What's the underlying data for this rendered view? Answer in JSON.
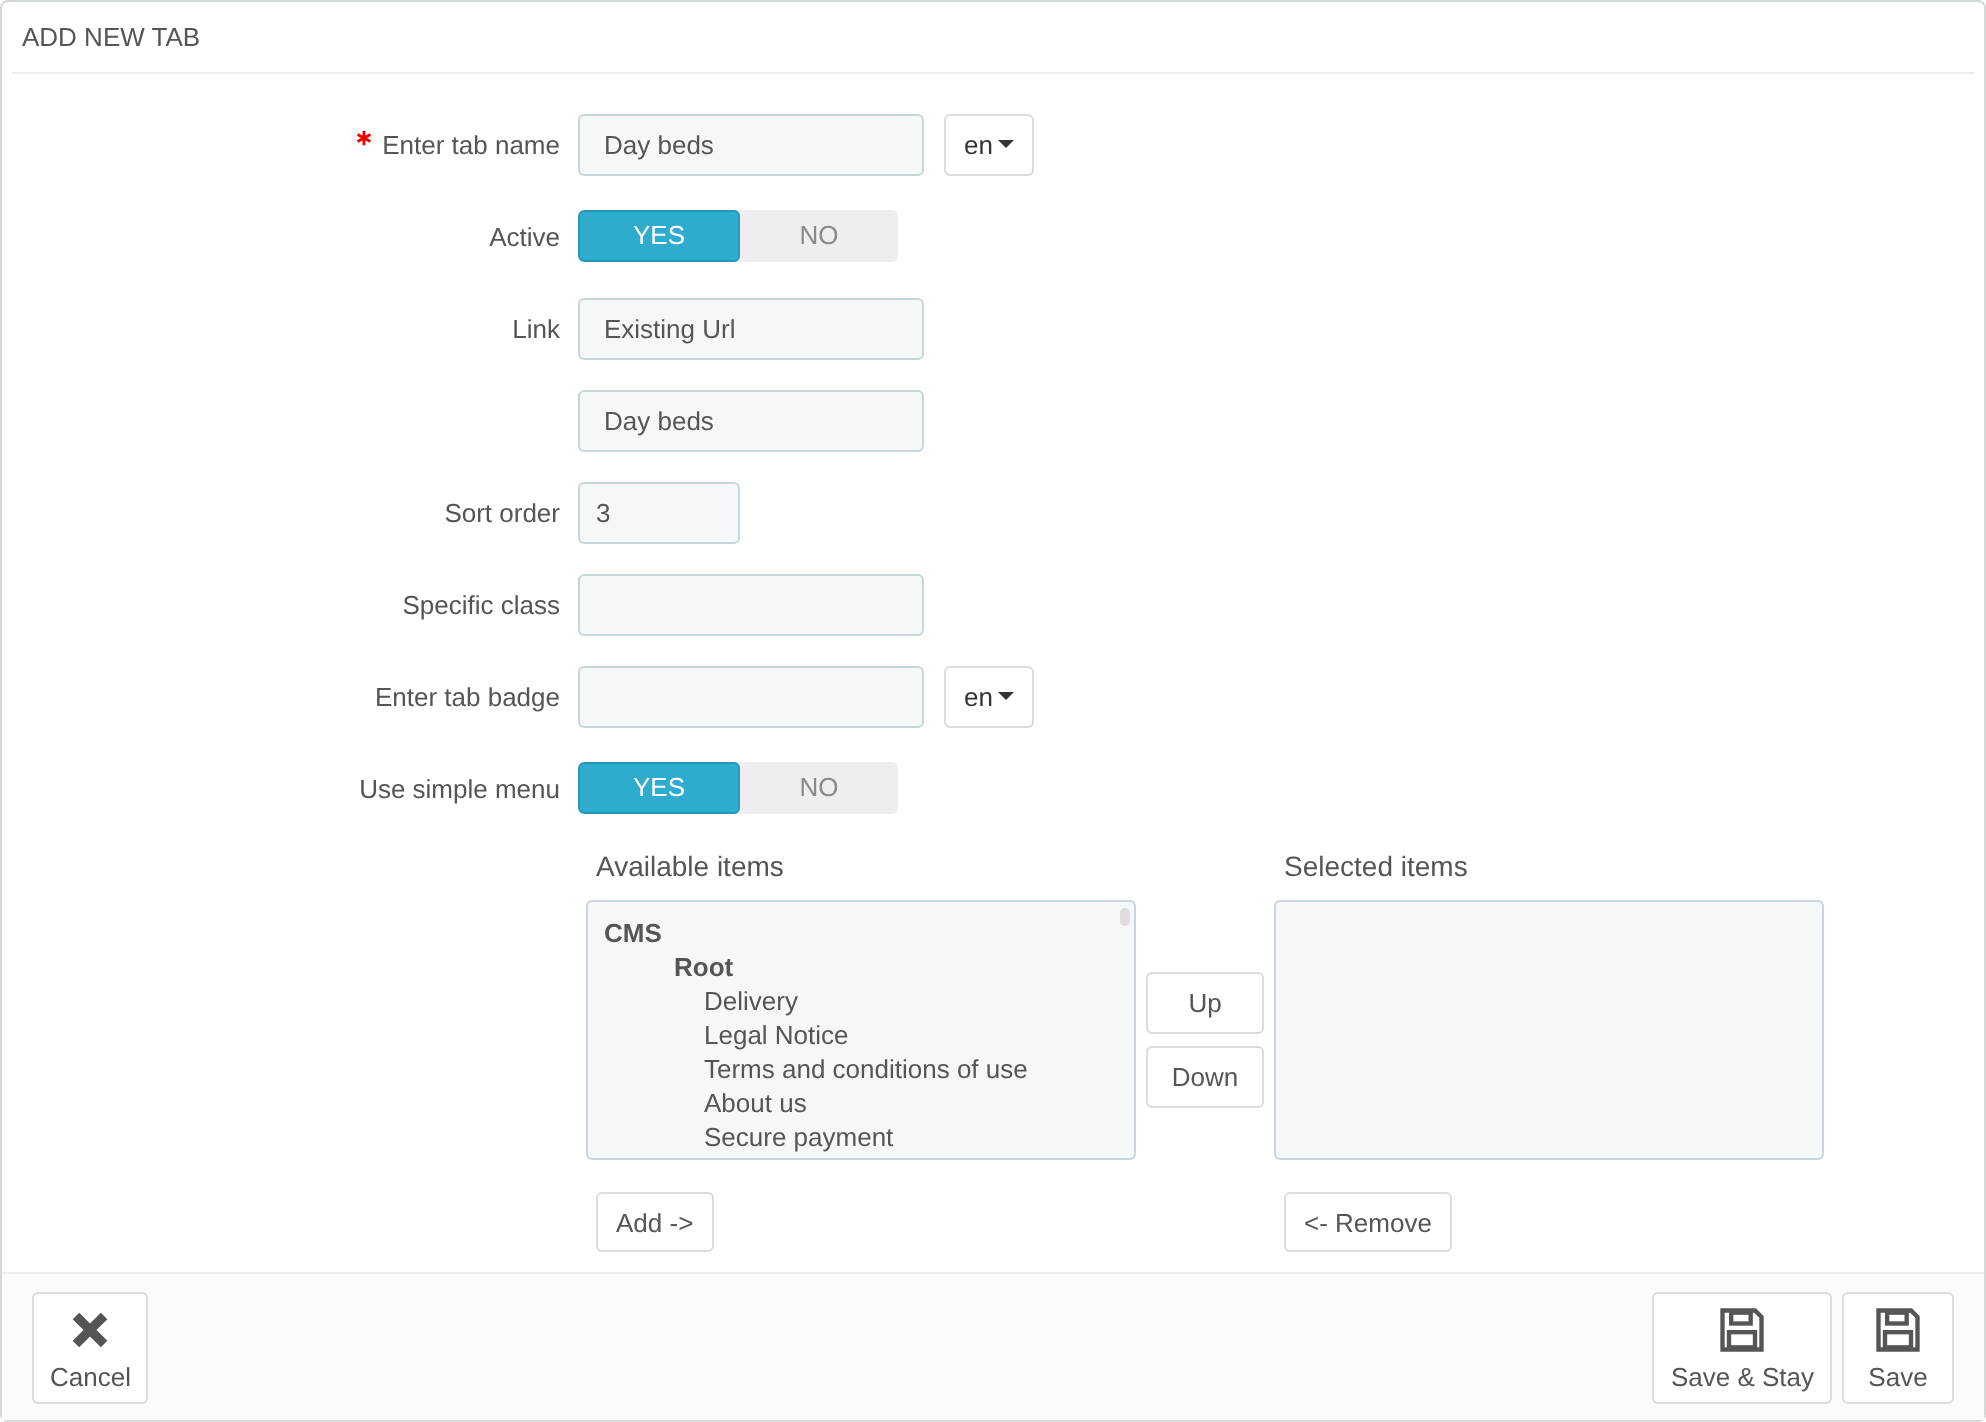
{
  "panel": {
    "title": "ADD NEW TAB"
  },
  "fields": [
    {
      "kind": "text",
      "label": "Enter tab name",
      "required": true,
      "value": "Day beds",
      "lang": "en"
    },
    {
      "kind": "toggle",
      "label": "Active",
      "required": false,
      "options": [
        "YES",
        "NO"
      ],
      "on": true
    },
    {
      "kind": "text",
      "label": "Link",
      "required": false,
      "value": "Existing Url"
    },
    {
      "kind": "text",
      "required": false,
      "value": "Day beds"
    },
    {
      "kind": "number",
      "label": "Sort order",
      "required": false,
      "value": "3"
    },
    {
      "kind": "text",
      "label": "Specific class",
      "required": false
    },
    {
      "kind": "text",
      "label": "Enter tab badge",
      "required": false,
      "lang": "en"
    },
    {
      "kind": "toggle",
      "label": "Use simple menu",
      "required": false,
      "options": [
        "YES",
        "NO"
      ],
      "on": true
    }
  ],
  "picker": {
    "available": {
      "title": "Available items",
      "items": [
        {
          "label": "CMS",
          "children": [
            {
              "label": "Root",
              "children": [
                {
                  "label": "Delivery"
                },
                {
                  "label": "Legal Notice"
                },
                {
                  "label": "Terms and conditions of use"
                },
                {
                  "label": "About us"
                },
                {
                  "label": "Secure payment"
                }
              ]
            }
          ]
        }
      ],
      "button": "Add ->"
    },
    "moves": [
      "Up",
      "Down"
    ],
    "selected": {
      "title": "Selected items",
      "button": "<- Remove"
    }
  },
  "footer": {
    "left": [
      {
        "kind": "cancel",
        "label": "Cancel"
      }
    ],
    "right": [
      {
        "kind": "save",
        "label": "Save & Stay"
      },
      {
        "kind": "save",
        "label": "Save"
      }
    ]
  }
}
